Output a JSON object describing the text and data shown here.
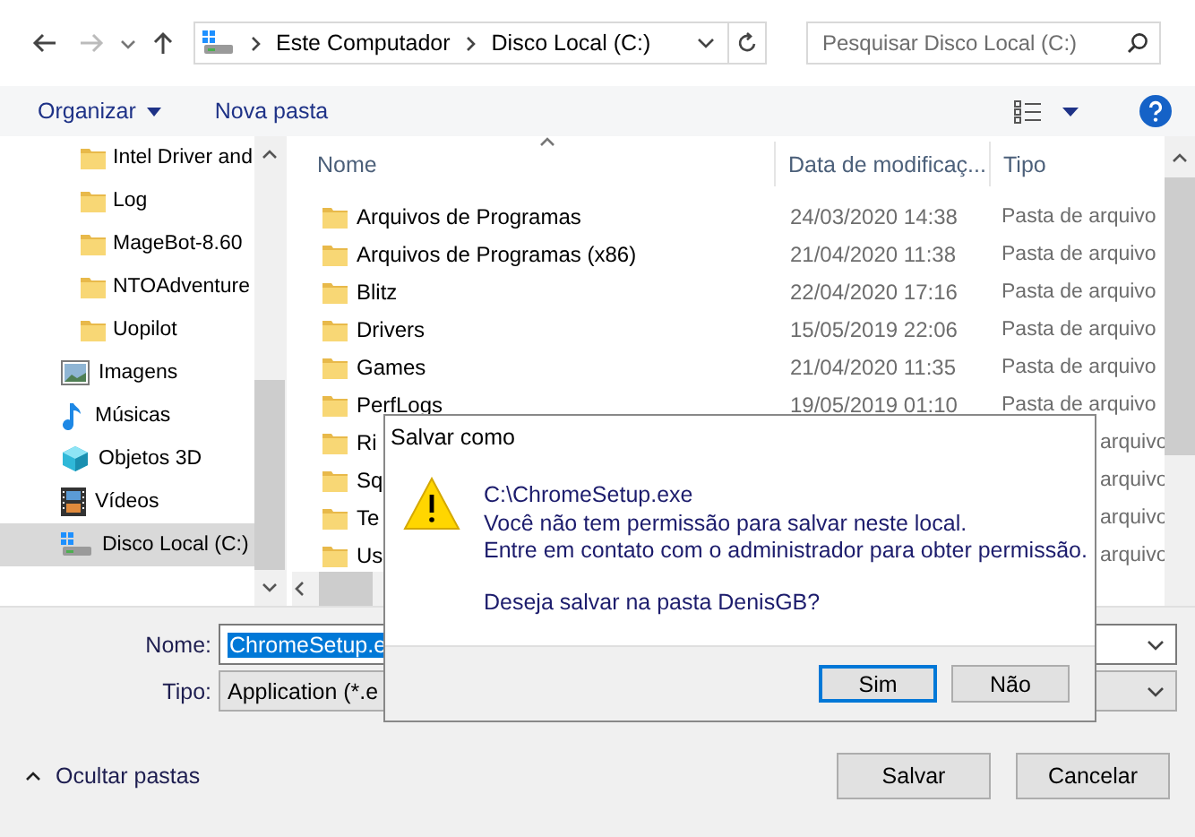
{
  "nav": {
    "path": [
      "Este Computador",
      "Disco Local (C:)"
    ],
    "search": {
      "placeholder": "Pesquisar Disco Local (C:)"
    }
  },
  "commands": [
    {
      "label": "Organizar",
      "kind": "menu"
    },
    {
      "label": "Nova pasta",
      "kind": "plain"
    }
  ],
  "sidebar": {
    "items": [
      {
        "label": "Intel Driver and",
        "kind": "subfolder",
        "selected": false
      },
      {
        "label": "Log",
        "kind": "subfolder",
        "selected": false
      },
      {
        "label": "MageBot-8.60",
        "kind": "subfolder",
        "selected": false
      },
      {
        "label": "NTOAdventure",
        "kind": "subfolder",
        "selected": false
      },
      {
        "label": "Uopilot",
        "kind": "subfolder",
        "selected": false
      },
      {
        "label": "Imagens",
        "kind": "pictures",
        "selected": false
      },
      {
        "label": "Músicas",
        "kind": "music",
        "selected": false
      },
      {
        "label": "Objetos 3D",
        "kind": "objects",
        "selected": false
      },
      {
        "label": "Vídeos",
        "kind": "videos",
        "selected": false
      },
      {
        "label": "Disco Local (C:)",
        "kind": "drive",
        "selected": true
      }
    ]
  },
  "files": {
    "columns": [
      "Nome",
      "Data de modificaç...",
      "Tipo"
    ],
    "rows": [
      {
        "name": "Arquivos de Programas",
        "date": "24/03/2020 14:38",
        "type": "Pasta de arquivo",
        "kind": "full"
      },
      {
        "name": "Arquivos de Programas (x86)",
        "date": "21/04/2020 11:38",
        "type": "Pasta de arquivo",
        "kind": "full"
      },
      {
        "name": "Blitz",
        "date": "22/04/2020 17:16",
        "type": "Pasta de arquivo",
        "kind": "full"
      },
      {
        "name": "Drivers",
        "date": "15/05/2019 22:06",
        "type": "Pasta de arquivo",
        "kind": "full"
      },
      {
        "name": "Games",
        "date": "21/04/2020 11:35",
        "type": "Pasta de arquivo",
        "kind": "full"
      },
      {
        "name": "PerfLogs",
        "date": "19/05/2019 01:10",
        "type": "Pasta de arquivo",
        "kind": "full"
      },
      {
        "name": "Ri",
        "type": "arquivo",
        "kind": "covered"
      },
      {
        "name": "Sq",
        "type": "arquivo",
        "kind": "covered"
      },
      {
        "name": "Te",
        "type": "arquivo",
        "kind": "covered"
      },
      {
        "name": "Us",
        "type": "arquivo",
        "kind": "covered"
      }
    ]
  },
  "form": {
    "name_label": "Nome:",
    "name_value": "ChromeSetup.e",
    "type_label": "Tipo:",
    "type_value": "Application (*.e"
  },
  "footer": {
    "toggle": "Ocultar pastas",
    "buttons": [
      "Salvar",
      "Cancelar"
    ]
  },
  "dialog": {
    "title": "Salvar como",
    "lines": [
      "C:\\ChromeSetup.exe",
      "Você não tem permissão para salvar neste local.",
      "Entre em contato com o administrador para obter permissão."
    ],
    "question": "Deseja salvar na pasta DenisGB?",
    "buttons": [
      {
        "label": "Sim",
        "default": true
      },
      {
        "label": "Não",
        "default": false
      }
    ]
  }
}
